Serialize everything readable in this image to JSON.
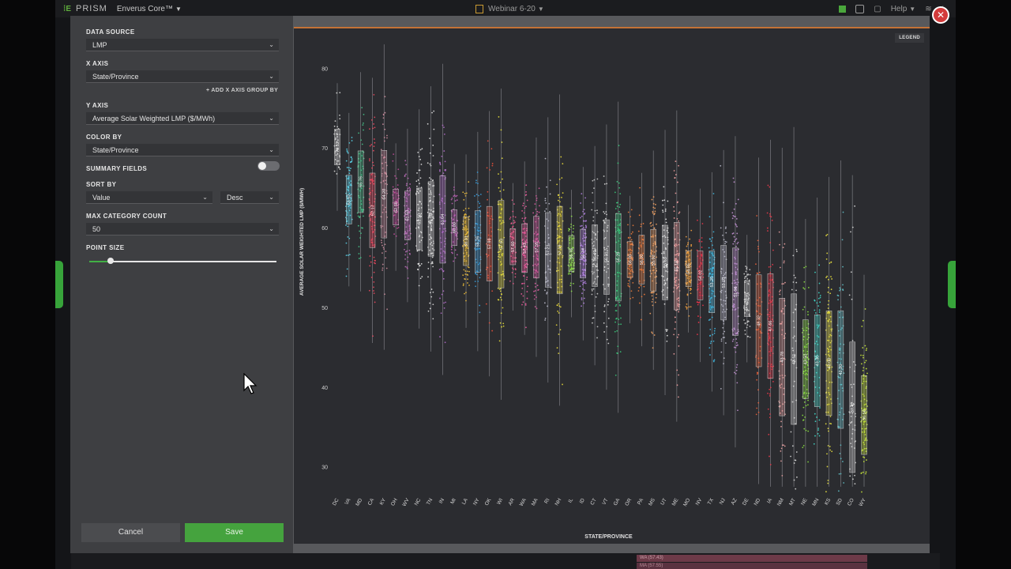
{
  "app": {
    "brand": "PRISM",
    "product": "Enverus Core™",
    "workspace": "Webinar 6-20",
    "help": "Help"
  },
  "config": {
    "data_source_label": "DATA SOURCE",
    "data_source_value": "LMP",
    "x_axis_label": "X AXIS",
    "x_axis_value": "State/Province",
    "add_group_by": "ADD X AXIS GROUP BY",
    "y_axis_label": "Y AXIS",
    "y_axis_value": "Average Solar Weighted LMP ($/MWh)",
    "color_by_label": "COLOR BY",
    "color_by_value": "State/Province",
    "summary_fields_label": "SUMMARY FIELDS",
    "summary_fields_on": false,
    "sort_by_label": "SORT BY",
    "sort_by_value": "Value",
    "sort_dir_value": "Desc",
    "max_category_label": "MAX CATEGORY COUNT",
    "max_category_value": "50",
    "point_size_label": "POINT SIZE",
    "point_size_level": 0.11
  },
  "buttons": {
    "cancel": "Cancel",
    "save": "Save"
  },
  "legend_label": "LEGEND",
  "background": {
    "bar1": "WA (57.43)",
    "bar2": "MA (57.55)"
  },
  "chart_data": {
    "type": "scatter",
    "subtype": "jittered box plot",
    "xlabel": "STATE/PROVINCE",
    "ylabel": "AVERAGE SOLAR WEIGHTED LMP ($/MWH)",
    "ylim": [
      26.5,
      84
    ],
    "yticks": [
      30,
      40,
      50,
      60,
      70,
      80
    ],
    "grid": false,
    "categories": [
      "DC",
      "VA",
      "MD",
      "CA",
      "KY",
      "OH",
      "WV",
      "NC",
      "TN",
      "IN",
      "MI",
      "LA",
      "NY",
      "OK",
      "WI",
      "AR",
      "WA",
      "MA",
      "RI",
      "NH",
      "IL",
      "ID",
      "CT",
      "VT",
      "GA",
      "OR",
      "PA",
      "MS",
      "UT",
      "ME",
      "MO",
      "NV",
      "TX",
      "NJ",
      "AZ",
      "DE",
      "ND",
      "IA",
      "NM",
      "MT",
      "NE",
      "MN",
      "KS",
      "SD",
      "CO",
      "WY"
    ],
    "medians": [
      70.12,
      63.52,
      65.76,
      62.17,
      64.2,
      62.58,
      61.53,
      61.1,
      61.1,
      61.04,
      60.0,
      58.31,
      58.26,
      57.99,
      57.93,
      57.6,
      57.43,
      57.55,
      57.21,
      57.19,
      56.76,
      56.74,
      56.49,
      56.31,
      56.29,
      56.0,
      56.0,
      55.92,
      55.63,
      55.18,
      54.85,
      54.02,
      53.2,
      53.1,
      51.96,
      51.1,
      48.32,
      47.66,
      43.78,
      43.51,
      43.5,
      43.3,
      43.0,
      42.2,
      37.47,
      36.5
    ],
    "series_colors": [
      "#d9d9d9",
      "#5ad2e8",
      "#46c48a",
      "#f2475e",
      "#c98a9a",
      "#c04a9a",
      "#b86ab6",
      "#e4e4e4",
      "#dcdcdc",
      "#b06cc8",
      "#c061b8",
      "#e8b93a",
      "#3a9bd8",
      "#e8503a",
      "#e8e03a",
      "#e85a8a",
      "#e85a9a",
      "#d85aa0",
      "#b8b8c8",
      "#e8d83a",
      "#8fe04a",
      "#b080e0",
      "#c8c8c8",
      "#d8d8d8",
      "#3ac87a",
      "#e87a3a",
      "#f07a3a",
      "#f0a060",
      "#e8e8e8",
      "#f0a0a0",
      "#f0a040",
      "#f0344a",
      "#40b8e0",
      "#b8b8c8",
      "#c090d0",
      "#c8c8c8",
      "#e8603a",
      "#e83a4a",
      "#e8a0a0",
      "#d8d8d8",
      "#8ae040",
      "#40d8c8",
      "#e8e040",
      "#60c0c8",
      "#d8d8d8",
      "#c8e83a"
    ]
  }
}
